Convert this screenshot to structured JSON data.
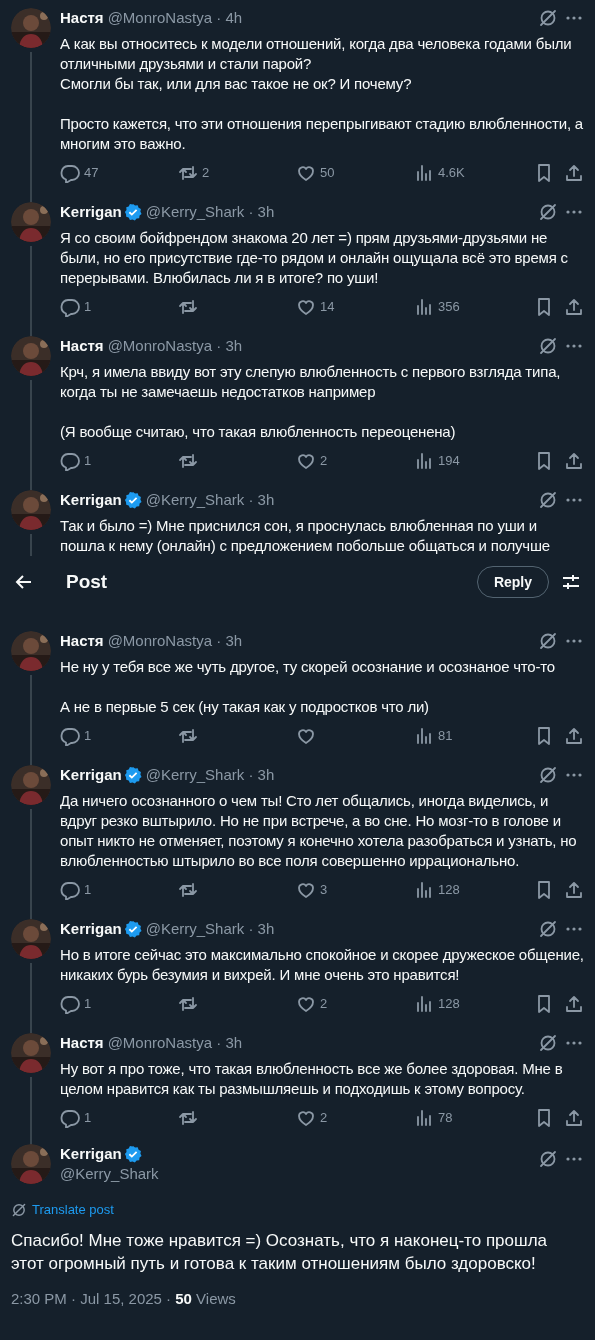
{
  "top_bar": {
    "title": "Post",
    "reply_button": "Reply"
  },
  "thread": [
    {
      "name": "Настя",
      "verified": false,
      "handle_time": "@MonroNastya · 4h",
      "thread_line": true,
      "body": "А как вы относитесь к модели отношений, когда два человека годами были отличными друзьями и стали парой?\nСмогли бы так, или для вас такое не ок? И почему?\n\nПросто кажется, что эти отношения перепрыгивают стадию влюбленности, а многим это важно.",
      "replies": "47",
      "reposts": "2",
      "likes": "50",
      "views": "4.6K"
    },
    {
      "name": "Kerrigan",
      "verified": true,
      "handle_time": "@Kerry_Shark · 3h",
      "thread_line": true,
      "body": "Я со своим бойфрендом знакома 20 лет =) прям друзьями-друзьями не были, но его присутствие где-то рядом и онлайн ощущала всё это время с перерывами. Влюбилась ли я в итоге? по уши!",
      "replies": "1",
      "likes": "14",
      "views": "356"
    },
    {
      "name": "Настя",
      "verified": false,
      "handle_time": "@MonroNastya · 3h",
      "thread_line": true,
      "body": "Крч, я имела ввиду вот эту слепую влюбленность с первого взгляда типа, когда ты не замечаешь недостатков например\n\n(Я вообще считаю, что такая влюбленность переоценена)",
      "replies": "1",
      "likes": "2",
      "views": "194"
    },
    {
      "name": "Kerrigan",
      "verified": true,
      "handle_time": "@Kerry_Shark · 3h",
      "thread_line": true,
      "body": "Так и было =) Мне приснился сон, я проснулась влюбленная по уши и пошла к нему (онлайн) с предложением побольше общаться и получше",
      "covered_by_bar": true
    },
    {
      "name": "Настя",
      "verified": false,
      "handle_time": "@MonroNastya · 3h",
      "thread_line": true,
      "body": "Не ну у тебя все же чуть другое, ту скорей осознание и осознаное что-то\n\nА не в первые 5 сек (ну такая как у подростков что ли)",
      "replies": "1",
      "views": "81"
    },
    {
      "name": "Kerrigan",
      "verified": true,
      "handle_time": "@Kerry_Shark · 3h",
      "thread_line": true,
      "body": "Да ничего осознанного о чем ты! Сто лет общались, иногда виделись, и вдруг резко вштырило. Но не при встрече, а во сне. Но мозг-то в голове и опыт никто не отменяет, поэтому я конечно хотела разобраться и узнать, но влюбленностью штырило во все поля совершенно иррационально.",
      "replies": "1",
      "likes": "3",
      "views": "128"
    },
    {
      "name": "Kerrigan",
      "verified": true,
      "handle_time": "@Kerry_Shark · 3h",
      "thread_line": true,
      "body": "Но в итоге сейчас это максимально спокойное и скорее дружеское общение, никаких бурь безумия и вихрей. И мне очень это нравится!",
      "replies": "1",
      "likes": "2",
      "views": "128"
    },
    {
      "name": "Настя",
      "verified": false,
      "handle_time": "@MonroNastya · 3h",
      "thread_line": true,
      "body": "Ну вот я про тоже, что такая влюбленность все же более здоровая. Мне в целом нравится как ты размышляешь и подходишь к этому вопросу.",
      "replies": "1",
      "likes": "2",
      "views": "78"
    }
  ],
  "main_post": {
    "name": "Kerrigan",
    "verified": true,
    "handle": "@Kerry_Shark",
    "translate": "Translate post",
    "body": "Спасибо! Мне тоже нравится =) Осознать, что я наконец-то прошла этот огромный путь и готова к таким отношениям было здоровско!",
    "meta": "2:30 PM · Jul 15, 2025 · **50** Views"
  }
}
